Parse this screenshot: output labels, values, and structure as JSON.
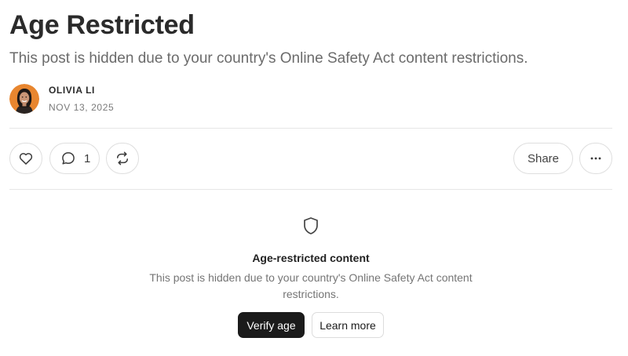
{
  "post": {
    "title": "Age Restricted",
    "subtitle": "This post is hidden due to your country's Online Safety Act content restrictions.",
    "author": "OLIVIA LI",
    "date": "NOV 13, 2025"
  },
  "actions": {
    "like_icon": "heart-icon",
    "comment_icon": "comment-bubble-icon",
    "comment_count": "1",
    "restack_icon": "restack-icon",
    "share_label": "Share",
    "more_icon": "ellipsis-icon"
  },
  "notice": {
    "icon": "shield-icon",
    "title": "Age-restricted content",
    "body": "This post is hidden due to your country's Online Safety Act content restrictions.",
    "primary_label": "Verify age",
    "secondary_label": "Learn more"
  },
  "colors": {
    "avatar_background": "#e8862f",
    "primary_button": "#1b1b1b",
    "divider": "#e6e6e6"
  }
}
